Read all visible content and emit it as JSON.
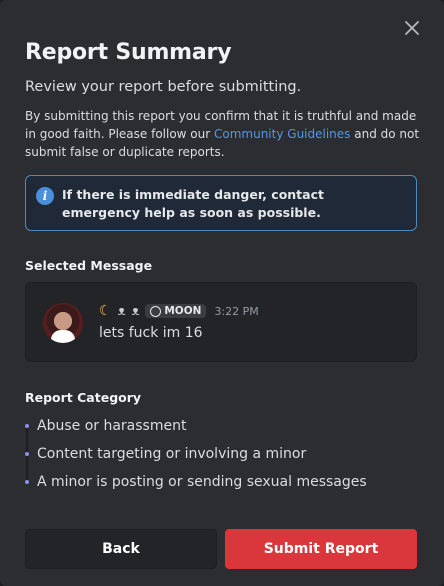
{
  "dialog": {
    "title": "Report Summary",
    "subtitle": "Review your report before submitting.",
    "disclaimer_before": "By submitting this report you confirm that it is truthful and made in good faith. Please follow our ",
    "disclaimer_link": "Community Guidelines",
    "disclaimer_after": " and do not submit false or duplicate reports.",
    "info_text": "If there is immediate danger, contact emergency help as soon as possible.",
    "close_icon": "close-icon",
    "info_icon": "info-icon"
  },
  "selected_message": {
    "label": "Selected Message",
    "tag": "MOON",
    "timestamp": "3:22 PM",
    "content": "lets fuck im 16"
  },
  "report_category": {
    "label": "Report Category",
    "items": [
      "Abuse or harassment",
      "Content targeting or involving a minor",
      "A minor is posting or sending sexual messages"
    ]
  },
  "buttons": {
    "back": "Back",
    "submit": "Submit Report"
  },
  "colors": {
    "background": "#2b2d31",
    "link": "#5197ed",
    "info_border": "#4d8ac0",
    "submit": "#da373c",
    "bullet": "#8b8ef0"
  }
}
